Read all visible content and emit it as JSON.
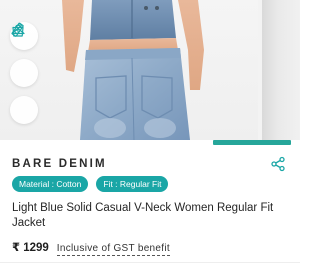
{
  "product": {
    "brand": "BARE DENIM",
    "tags": [
      {
        "key": "Material",
        "value": "Cotton",
        "label": "Material : Cotton"
      },
      {
        "key": "Fit",
        "value": "Regular Fit",
        "label": "Fit : Regular Fit"
      }
    ],
    "title": "Light Blue Solid Casual V-Neck Women Regular Fit Jacket",
    "price": "₹ 1299",
    "tax_note": "Inclusive of GST benefit"
  },
  "gallery": {
    "actions": [
      {
        "name": "hanger-icon"
      },
      {
        "name": "ruler-icon"
      },
      {
        "name": "bag-icon"
      }
    ],
    "image_progress": 0.26
  },
  "colors": {
    "accent": "#1aa6a6",
    "progress": "#26a69a",
    "denim_light": "#9fb8d2",
    "denim_dark": "#6f8fb3"
  }
}
